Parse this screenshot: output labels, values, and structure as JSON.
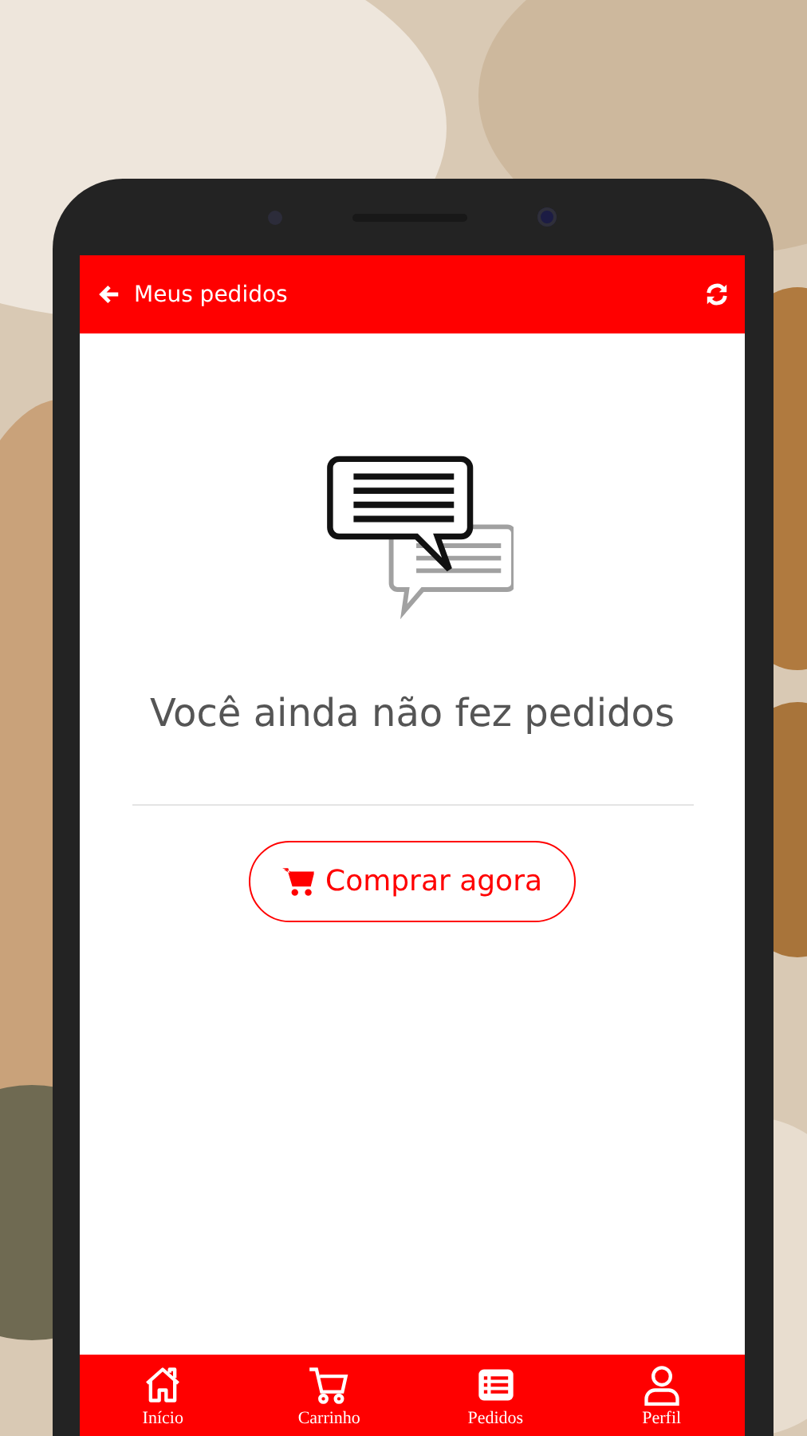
{
  "header": {
    "title": "Meus pedidos"
  },
  "empty_state": {
    "message": "Você ainda não fez pedidos",
    "button": "Comprar agora"
  },
  "bottom_nav": [
    {
      "kind": "home",
      "label": "Início"
    },
    {
      "kind": "cart",
      "label": "Carrinho"
    },
    {
      "kind": "list",
      "label": "Pedidos"
    },
    {
      "kind": "user",
      "label": "Perfil"
    }
  ]
}
